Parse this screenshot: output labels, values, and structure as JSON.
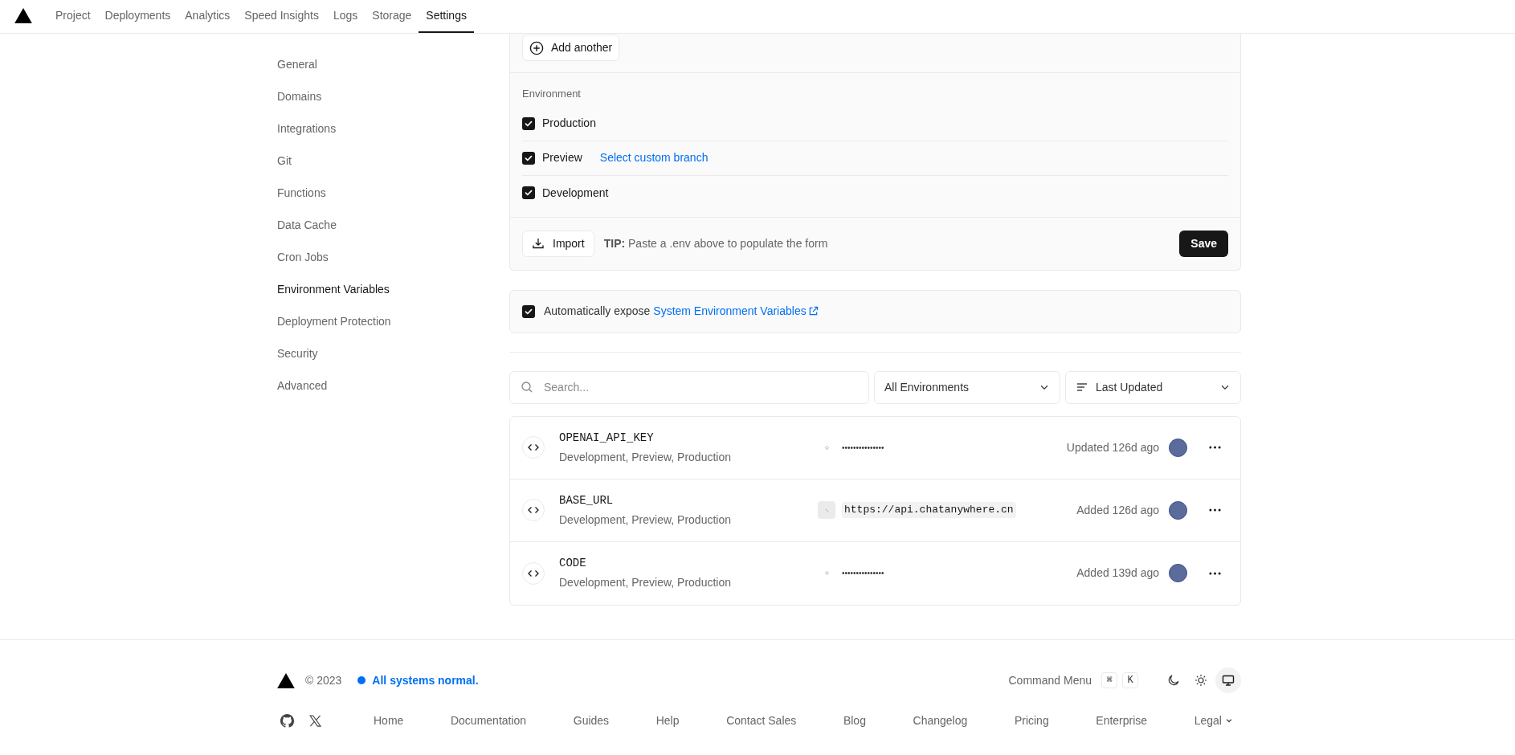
{
  "nav": {
    "tabs": [
      {
        "label": "Project",
        "selected": false
      },
      {
        "label": "Deployments",
        "selected": false
      },
      {
        "label": "Analytics",
        "selected": false
      },
      {
        "label": "Speed Insights",
        "selected": false
      },
      {
        "label": "Logs",
        "selected": false
      },
      {
        "label": "Storage",
        "selected": false
      },
      {
        "label": "Settings",
        "selected": true
      }
    ]
  },
  "sidebar": {
    "items": [
      {
        "label": "General",
        "selected": false
      },
      {
        "label": "Domains",
        "selected": false
      },
      {
        "label": "Integrations",
        "selected": false
      },
      {
        "label": "Git",
        "selected": false
      },
      {
        "label": "Functions",
        "selected": false
      },
      {
        "label": "Data Cache",
        "selected": false
      },
      {
        "label": "Cron Jobs",
        "selected": false
      },
      {
        "label": "Environment Variables",
        "selected": true
      },
      {
        "label": "Deployment Protection",
        "selected": false
      },
      {
        "label": "Security",
        "selected": false
      },
      {
        "label": "Advanced",
        "selected": false
      }
    ]
  },
  "form": {
    "add_button": "Add another",
    "environment_label": "Environment",
    "environments": [
      {
        "label": "Production",
        "checked": true
      },
      {
        "label": "Preview",
        "checked": true,
        "link": "Select custom branch"
      },
      {
        "label": "Development",
        "checked": true
      }
    ],
    "import_button": "Import",
    "tip": "**TIP:** Paste a .env above to populate the form",
    "save_button": "Save"
  },
  "auto_expose": {
    "checked": true,
    "text": "Automatically expose",
    "link": "System Environment Variables"
  },
  "filters": {
    "search_placeholder": "Search...",
    "environment_select": "All Environments",
    "sort_select": "Last Updated"
  },
  "variables": [
    {
      "name": "OPENAI_API_KEY",
      "environments": "Development, Preview, Production",
      "kind": "hidden",
      "value": "•••••••••••••••",
      "time": "Updated 126d ago"
    },
    {
      "name": "BASE_URL",
      "environments": "Development, Preview, Production",
      "kind": "plain",
      "value": "https://api.chatanywhere.cn",
      "time": "Added 126d ago"
    },
    {
      "name": "CODE",
      "environments": "Development, Preview, Production",
      "kind": "hidden",
      "value": "•••••••••••••••",
      "time": "Added 139d ago"
    }
  ],
  "footer": {
    "copyright": "© 2023",
    "status": {
      "text": "All systems normal.",
      "color": "#0070f3"
    },
    "command_menu": "Command Menu",
    "keys": [
      "⌘",
      "K"
    ],
    "theme_buttons": [
      {
        "kind": "dark",
        "selected": false
      },
      {
        "kind": "light",
        "selected": false
      },
      {
        "kind": "system",
        "selected": true
      }
    ],
    "links": [
      "Home",
      "Documentation",
      "Guides",
      "Help",
      "Contact Sales",
      "Blog",
      "Changelog",
      "Pricing",
      "Enterprise"
    ],
    "legal": "Legal"
  }
}
